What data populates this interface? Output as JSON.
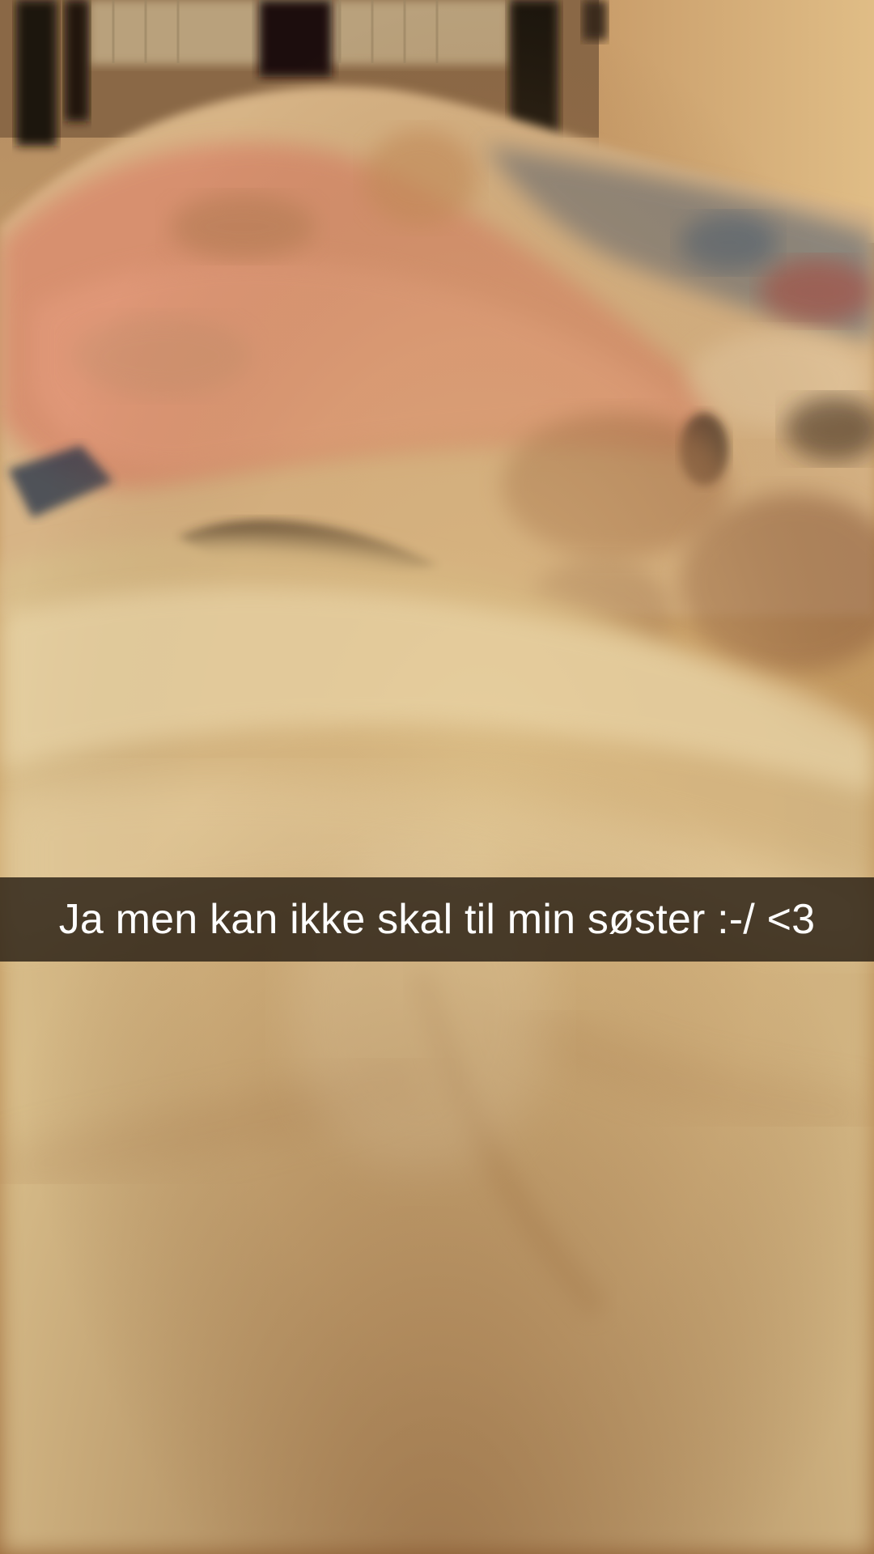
{
  "snap": {
    "caption": "Ja men kan ikke skal til min søster :-/ <3",
    "caption_bar_color": "#2a1e14",
    "caption_text_color": "#ffffff"
  }
}
